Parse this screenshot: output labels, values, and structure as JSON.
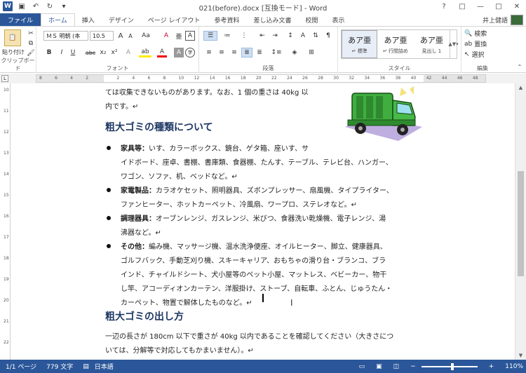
{
  "window": {
    "title": "021(before).docx [互換モード] - Word",
    "help": "?",
    "ribbon_options": "□",
    "minimize": "—",
    "maximize": "□",
    "close": "✕"
  },
  "qat": {
    "logo": "W",
    "save": "💾",
    "undo": "↶",
    "redo": "↻",
    "customize": "▾"
  },
  "tabs": {
    "file": "ファイル",
    "home": "ホーム",
    "insert": "挿入",
    "design": "デザイン",
    "layout": "ページ レイアウト",
    "references": "参考資料",
    "mailings": "差し込み文書",
    "review": "校閲",
    "view": "表示",
    "user": "井上健語"
  },
  "ribbon": {
    "clipboard": {
      "paste": "貼り付け",
      "label": "クリップボード"
    },
    "font": {
      "name": "ＭＳ 明朝 (本",
      "size": "10.5",
      "grow": "A",
      "shrink": "A",
      "aa": "Aa",
      "clear": "A",
      "phonetic": "亜",
      "border": "A",
      "bold": "B",
      "italic": "I",
      "underline": "U",
      "strike": "abc",
      "sub": "x₂",
      "sup": "x²",
      "effects": "A",
      "highlight": "ab",
      "color": "A",
      "shade": "A",
      "enclose": "字",
      "label": "フォント"
    },
    "paragraph": {
      "label": "段落"
    },
    "styles": {
      "items": [
        {
          "sample": "あア亜",
          "name": "↵ 標準"
        },
        {
          "sample": "あア亜",
          "name": "↵ 行間詰め"
        },
        {
          "sample": "あア亜",
          "name": "見出し 1"
        }
      ],
      "label": "スタイル"
    },
    "editing": {
      "find": "検索",
      "replace": "置換",
      "select": "選択",
      "label": "編集"
    }
  },
  "ruler": {
    "ticks": [
      "8",
      "6",
      "4",
      "2",
      "",
      "2",
      "4",
      "6",
      "8",
      "10",
      "12",
      "14",
      "16",
      "18",
      "20",
      "22",
      "24",
      "26",
      "28",
      "30",
      "32",
      "34",
      "36",
      "38",
      "40",
      "42",
      "44",
      "46",
      "48"
    ]
  },
  "vruler": {
    "ticks": [
      "10",
      "11",
      "12",
      "13",
      "14",
      "15",
      "16",
      "17",
      "18",
      "19",
      "20",
      "21",
      "22"
    ]
  },
  "document": {
    "line1": "ては収集できないものがあります。なお、1 個の重さは 40kg 以",
    "line2": "内です。↵",
    "heading1": "粗大ゴミの種類について",
    "bullets": [
      {
        "label": "家具等：",
        "lines": [
          "いす、カラーボックス、鏡台、ゲタ箱、座いす、サ",
          "イドボード、座卓、書棚、書庫類、食器棚、たんす、テーブル、テレビ台、ハンガー、",
          "ワゴン、ソファ、机、ベッドなど。↵"
        ]
      },
      {
        "label": "家電製品：",
        "lines": [
          "カラオケセット、照明器具、ズボンプレッサー、扇風機、タイプライター、",
          "ファンヒーター、ホットカーペット、冷風扇、ワープロ、ステレオなど。↵"
        ]
      },
      {
        "label": "調理器具：",
        "lines": [
          "オーブンレンジ、ガスレンジ、米びつ、食器洗い乾燥機、電子レンジ、湯",
          "沸器など。↵"
        ]
      },
      {
        "label": "その他：",
        "lines": [
          "編み機、マッサージ機、温水洗浄便座、オイルヒーター、脚立、健康器具、",
          "ゴルフバック、手動芝刈り機、スキーキャリア、おもちゃの滑り台・ブランコ、ブラ",
          "インド、チャイルドシート、犬小屋等のペット小屋、マットレス、ベビーカー、物干",
          "し竿、アコーディオンカーテン、洋服掛け、ストーブ、自転車、ふとん、じゅうたん・",
          "カーペット、物置で解体したものなど。↵"
        ]
      }
    ],
    "heading2": "粗大ゴミの出し方",
    "para1": "一辺の長さが 180cm 以下で重さが 40kg 以内であることを確認してください（大きさにつ",
    "para2": "いては、分解等で対応してもかまいません）。↵"
  },
  "status": {
    "page": "1/1 ページ",
    "words": "779 文字",
    "lang": "日本語",
    "zoom": "110%",
    "zoom_fraction": 0.55
  },
  "colors": {
    "accent": "#2b579a",
    "heading": "#1f3864",
    "truck": "#3fae3f"
  }
}
